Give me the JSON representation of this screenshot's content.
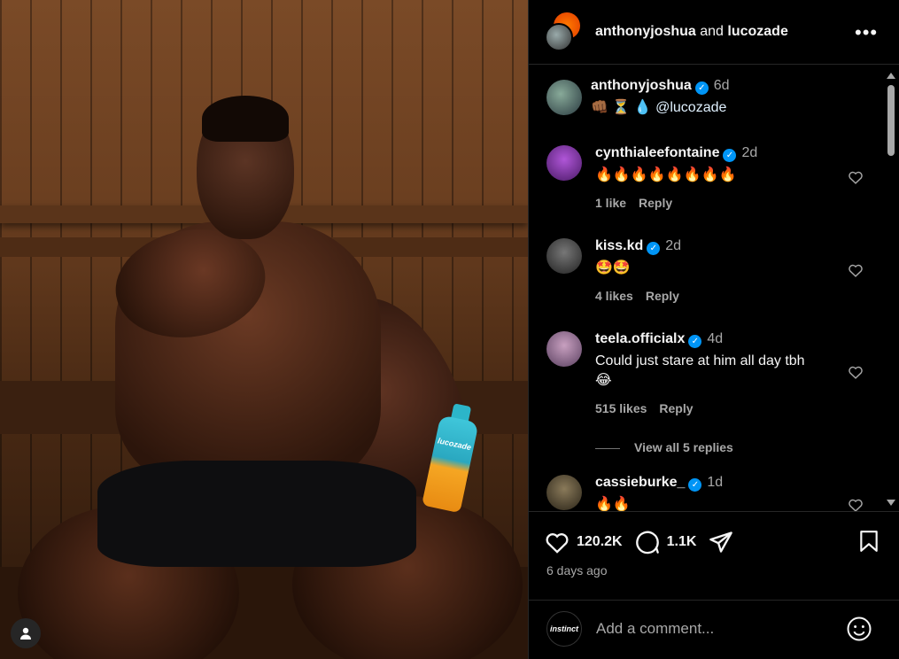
{
  "header": {
    "user1": "anthonyjoshua",
    "connector": "and",
    "user2": "lucozade",
    "more_label": "•••"
  },
  "caption": {
    "username": "anthonyjoshua",
    "time": "6d",
    "text_emoji": "👊🏾 ⏳ 💧",
    "mention": "@lucozade"
  },
  "comments": [
    {
      "username": "cynthialeefontaine",
      "time": "2d",
      "text": "🔥🔥🔥🔥🔥🔥🔥🔥",
      "likes": "1 like",
      "reply": "Reply"
    },
    {
      "username": "kiss.kd",
      "time": "2d",
      "text": "🤩🤩",
      "likes": "4 likes",
      "reply": "Reply"
    },
    {
      "username": "teela.officialx",
      "time": "4d",
      "text": "Could just stare at him all day tbh",
      "text2": "😂",
      "likes": "515 likes",
      "reply": "Reply"
    },
    {
      "username": "cassieburke_",
      "time": "1d",
      "text": "🔥🔥"
    }
  ],
  "view_replies": "View all 5 replies",
  "actions": {
    "like_count": "120.2K",
    "comment_count": "1.1K",
    "posted": "6 days ago"
  },
  "add_comment": {
    "placeholder": "Add a comment...",
    "avatar_text": "instinct"
  },
  "media": {
    "bottle_label": "lucozade"
  },
  "colors": {
    "verified": "#0095f6",
    "background": "#000000",
    "muted": "#a8a8a8"
  }
}
